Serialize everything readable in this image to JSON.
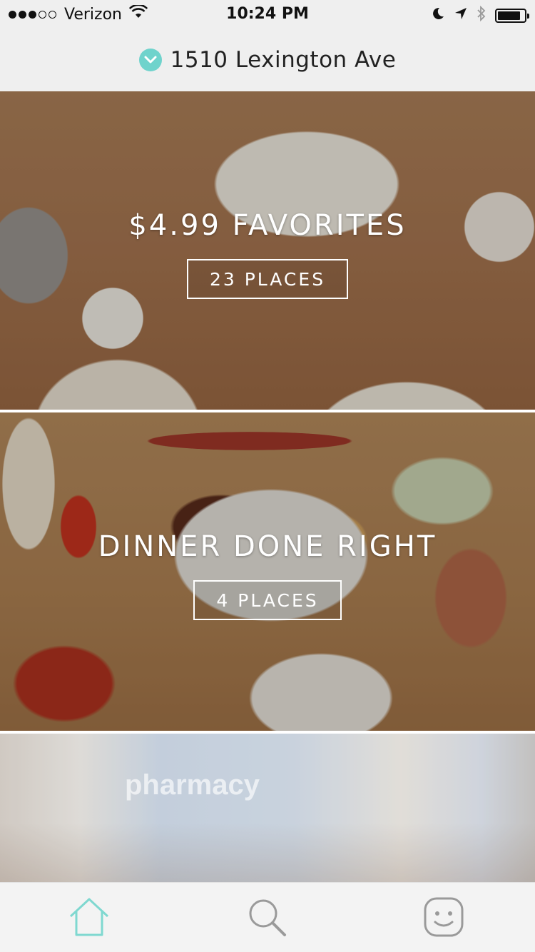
{
  "status_bar": {
    "carrier": "Verizon",
    "time": "10:24 PM",
    "signal_bars_filled": 3,
    "signal_bars_total": 5,
    "battery_level": 0.85
  },
  "header": {
    "address": "1510 Lexington Ave",
    "accent_color": "#6fd3cc"
  },
  "collections": [
    {
      "title": "$4.99 FAVORITES",
      "places_label": "23 PLACES"
    },
    {
      "title": "DINNER DONE RIGHT",
      "places_label": "4 PLACES"
    },
    {
      "sign_text": "pharmacy"
    }
  ],
  "tab_bar": {
    "items": [
      {
        "icon": "home-icon",
        "active": true
      },
      {
        "icon": "search-icon",
        "active": false
      },
      {
        "icon": "smiley-icon",
        "active": false
      }
    ],
    "active_color": "#7fd8d0",
    "inactive_color": "#9a9a9a"
  }
}
